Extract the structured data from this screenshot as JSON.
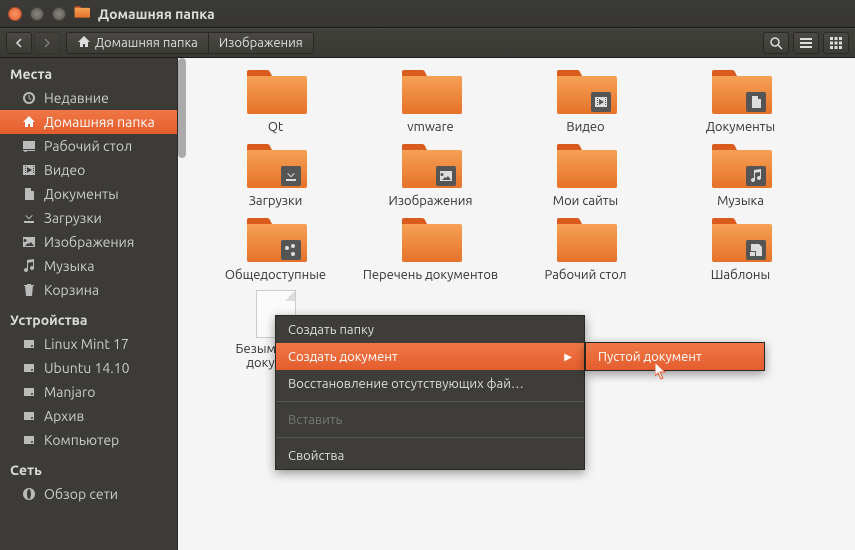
{
  "window": {
    "title": "Домашняя папка"
  },
  "breadcrumb": {
    "home_label": "Домашняя папка",
    "current_label": "Изображения"
  },
  "sidebar": {
    "sections": [
      {
        "header": "Места",
        "items": [
          {
            "icon": "clock",
            "label": "Недавние",
            "active": false
          },
          {
            "icon": "home",
            "label": "Домашняя папка",
            "active": true
          },
          {
            "icon": "desktop",
            "label": "Рабочий стол",
            "active": false
          },
          {
            "icon": "video",
            "label": "Видео",
            "active": false
          },
          {
            "icon": "doc",
            "label": "Документы",
            "active": false
          },
          {
            "icon": "download",
            "label": "Загрузки",
            "active": false
          },
          {
            "icon": "photo",
            "label": "Изображения",
            "active": false
          },
          {
            "icon": "music",
            "label": "Музыка",
            "active": false
          },
          {
            "icon": "trash",
            "label": "Корзина",
            "active": false
          }
        ]
      },
      {
        "header": "Устройства",
        "items": [
          {
            "icon": "hdd",
            "label": "Linux Mint 17"
          },
          {
            "icon": "hdd",
            "label": "Ubuntu 14.10"
          },
          {
            "icon": "hdd",
            "label": "Manjaro"
          },
          {
            "icon": "hdd",
            "label": "Архив"
          },
          {
            "icon": "hdd",
            "label": "Компьютер"
          }
        ]
      },
      {
        "header": "Сеть",
        "items": [
          {
            "icon": "net",
            "label": "Обзор сети"
          }
        ]
      }
    ]
  },
  "files": [
    {
      "name": "Qt",
      "type": "folder"
    },
    {
      "name": "vmware",
      "type": "folder"
    },
    {
      "name": "Видео",
      "type": "folder",
      "emblem": "video"
    },
    {
      "name": "Документы",
      "type": "folder",
      "emblem": "doc"
    },
    {
      "name": "Загрузки",
      "type": "folder",
      "emblem": "download"
    },
    {
      "name": "Изображения",
      "type": "folder",
      "emblem": "photo"
    },
    {
      "name": "Мои сайты",
      "type": "folder"
    },
    {
      "name": "Музыка",
      "type": "folder",
      "emblem": "music"
    },
    {
      "name": "Общедоступные",
      "type": "folder",
      "emblem": "share"
    },
    {
      "name": "Перечень документов",
      "type": "folder"
    },
    {
      "name": "Рабочий стол",
      "type": "folder",
      "variant": "desktop"
    },
    {
      "name": "Шаблоны",
      "type": "folder",
      "emblem": "template"
    },
    {
      "name": "Безымянный документ",
      "type": "doc"
    }
  ],
  "context_menu": {
    "items": [
      {
        "label": "Создать папку",
        "enabled": true
      },
      {
        "label": "Создать документ",
        "enabled": true,
        "submenu": true,
        "highlighted": true
      },
      {
        "label": "Восстановление отсутствующих фай…",
        "enabled": true
      },
      {
        "label": "Вставить",
        "enabled": false
      },
      {
        "label": "Свойства",
        "enabled": true
      }
    ],
    "submenu": [
      {
        "label": "Пустой документ",
        "highlighted": true
      }
    ]
  }
}
